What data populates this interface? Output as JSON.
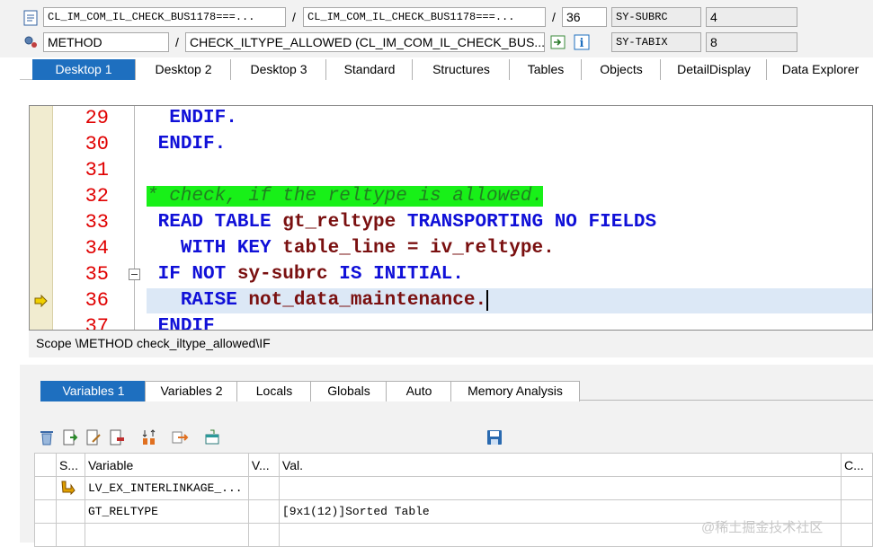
{
  "header": {
    "row1": {
      "field1": "CL_IM_COM_IL_CHECK_BUS1178===...",
      "sep1": "/",
      "field2": "CL_IM_COM_IL_CHECK_BUS1178===...",
      "sep2": "/",
      "line": "36",
      "var_name": "SY-SUBRC",
      "var_value": "4"
    },
    "row2": {
      "field1": "METHOD",
      "sep1": "/",
      "field2": "CHECK_ILTYPE_ALLOWED (CL_IM_COM_IL_CHECK_BUS...",
      "var_name": "SY-TABIX",
      "var_value": "8"
    }
  },
  "tabs": [
    "Desktop 1",
    "Desktop 2",
    "Desktop 3",
    "Standard",
    "Structures",
    "Tables",
    "Objects",
    "DetailDisplay",
    "Data Explorer"
  ],
  "code": {
    "line_numbers": [
      "29",
      "30",
      "31",
      "32",
      "33",
      "34",
      "35",
      "36",
      "37"
    ],
    "lines": [
      {
        "t1": "  ",
        "kw1": "ENDIF."
      },
      {
        "t1": " ",
        "kw1": "ENDIF."
      },
      {},
      {
        "comment": "* check, if the reltype is allowed."
      },
      {
        "t1": " ",
        "kw1": "READ TABLE",
        "id1": " gt_reltype ",
        "kw2": "TRANSPORTING NO FIELDS"
      },
      {
        "t1": "   ",
        "kw1": "WITH KEY",
        "id1": " table_line = iv_reltype."
      },
      {
        "t1": " ",
        "kw1": "IF NOT",
        "id1": " sy-subrc ",
        "kw2": "IS INITIAL."
      },
      {
        "t1": "   ",
        "kw1": "RAISE",
        "id1": " not_data_maintenance."
      },
      {
        "t1": " ",
        "kw1": "ENDIF"
      }
    ]
  },
  "scope": "Scope \\METHOD check_iltype_allowed\\IF",
  "var_tabs": [
    "Variables 1",
    "Variables 2",
    "Locals",
    "Globals",
    "Auto",
    "Memory Analysis"
  ],
  "grid": {
    "headers": [
      "S...",
      "Variable",
      "V...",
      "Val.",
      "C..."
    ],
    "rows": [
      {
        "variable": "LV_EX_INTERLINKAGE_...",
        "value": ""
      },
      {
        "variable": "GT_RELTYPE",
        "value": "[9x1(12)]Sorted Table"
      },
      {
        "variable": "",
        "value": ""
      }
    ]
  },
  "watermark": "@稀土掘金技术社区",
  "colors": {
    "accent": "#1e6fbf",
    "keyword": "#1010d8",
    "identifier": "#7a1010",
    "comment_bg": "#18f018",
    "line_number": "#e00000"
  },
  "icons": [
    "program-icon",
    "method-icon",
    "navigate-icon",
    "info-icon",
    "delete-icon",
    "insert-row-icon",
    "edit-row-icon",
    "remove-row-icon",
    "sort-icon",
    "transfer-icon",
    "export-icon",
    "save-icon",
    "debug-arrow-icon",
    "collapse-icon",
    "variable-type-icon"
  ]
}
